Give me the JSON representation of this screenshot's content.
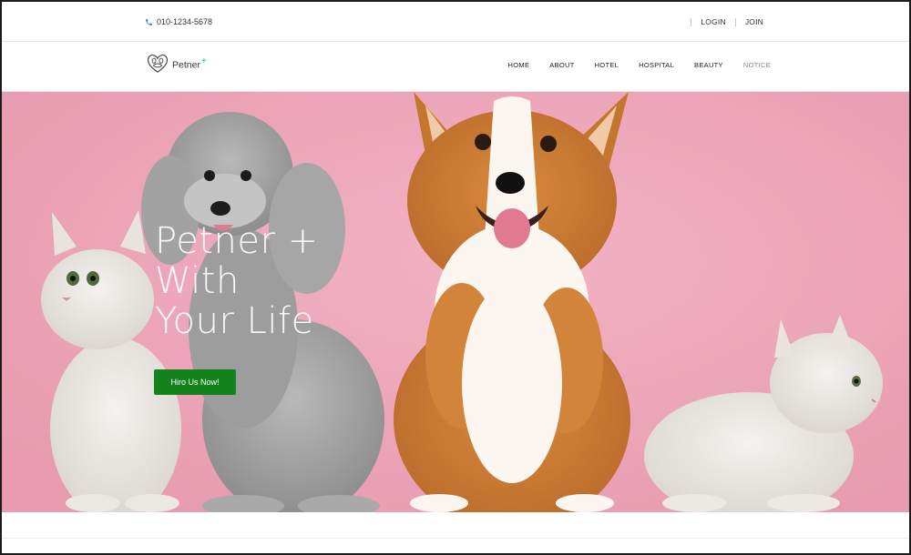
{
  "topbar": {
    "phone_icon": "phone-icon",
    "phone": "010-1234-5678",
    "login": "LOGIN",
    "join": "JOIN"
  },
  "brand": {
    "logo_icon": "heart-paw-logo-icon",
    "name": "Petner",
    "plus": "+",
    "accent": "#2aa6a0"
  },
  "nav": {
    "items": [
      {
        "label": "HOME"
      },
      {
        "label": "ABOUT"
      },
      {
        "label": "HOTEL"
      },
      {
        "label": "HOSPITAL"
      },
      {
        "label": "BEAUTY"
      },
      {
        "label": "NOTICE"
      }
    ]
  },
  "hero": {
    "title_lines": [
      "Petner +",
      "With",
      "Your Life"
    ],
    "cta_label": "Hiro Us Now!",
    "cta_color": "#15831c",
    "background": "#eea7ba",
    "image_subject": "photo-of-two-cats-poodle-and-corgi"
  }
}
